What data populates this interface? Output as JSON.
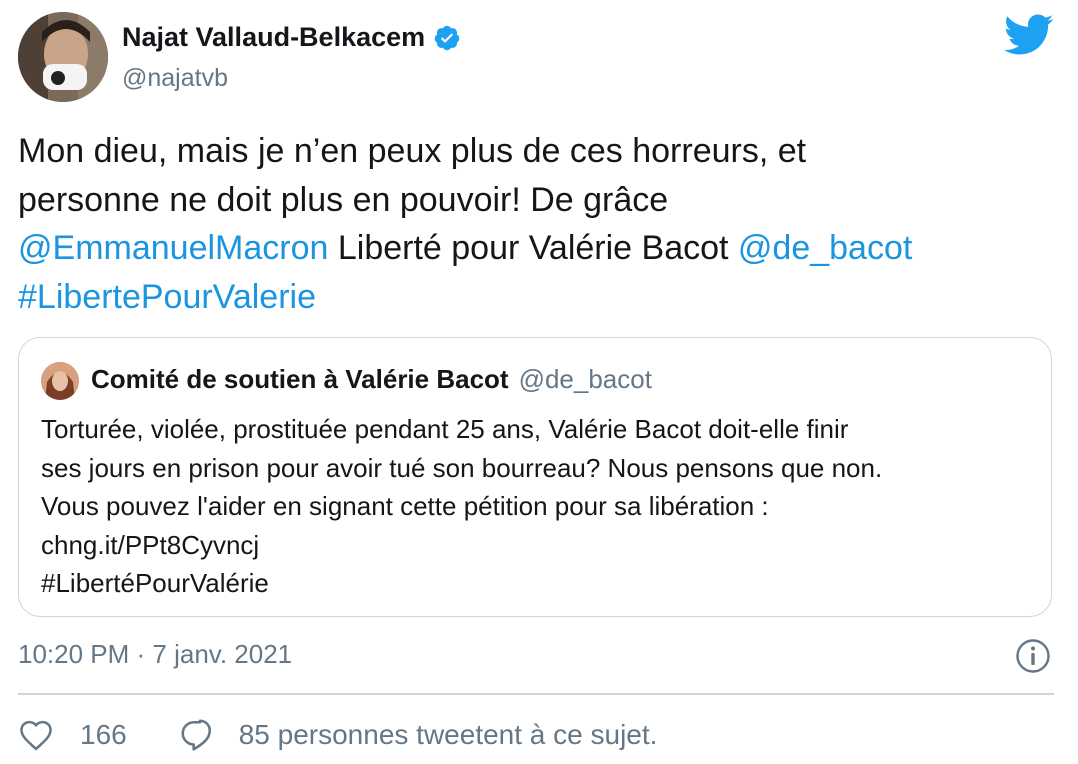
{
  "author": {
    "name": "Najat Vallaud-Belkacem",
    "handle": "@najatvb",
    "avatar_icon": "profile-photo-masked"
  },
  "tweet": {
    "text_line1": "Mon dieu, mais je n’en peux plus de ces horreurs, et",
    "text_line2": "personne ne doit plus en pouvoir! De grâce",
    "mention1": "@EmmanuelMacron",
    "text_line3_mid": " Liberté pour Valérie Bacot ",
    "mention2": "@de_bacot",
    "hashtag": "#LibertePourValerie"
  },
  "quoted": {
    "name": "Comité de soutien à Valérie Bacot",
    "handle": "@de_bacot",
    "lines": [
      "Torturée, violée, prostituée pendant 25 ans, Valérie Bacot doit-elle finir",
      "ses jours en prison pour avoir tué son bourreau? Nous pensons que non.",
      "Vous pouvez l'aider en signant cette pétition pour sa libération :",
      "chng.it/PPt8Cyvncj",
      "#LibertéPourValérie"
    ]
  },
  "meta": {
    "timestamp": "10:20 PM · 7 janv. 2021"
  },
  "actions": {
    "likes": "166",
    "discussion": "85 personnes tweetent à ce sujet."
  },
  "colors": {
    "link": "#1b95e0",
    "secondary": "#657786",
    "border": "#ccd6dd",
    "brand": "#1da1f2"
  }
}
